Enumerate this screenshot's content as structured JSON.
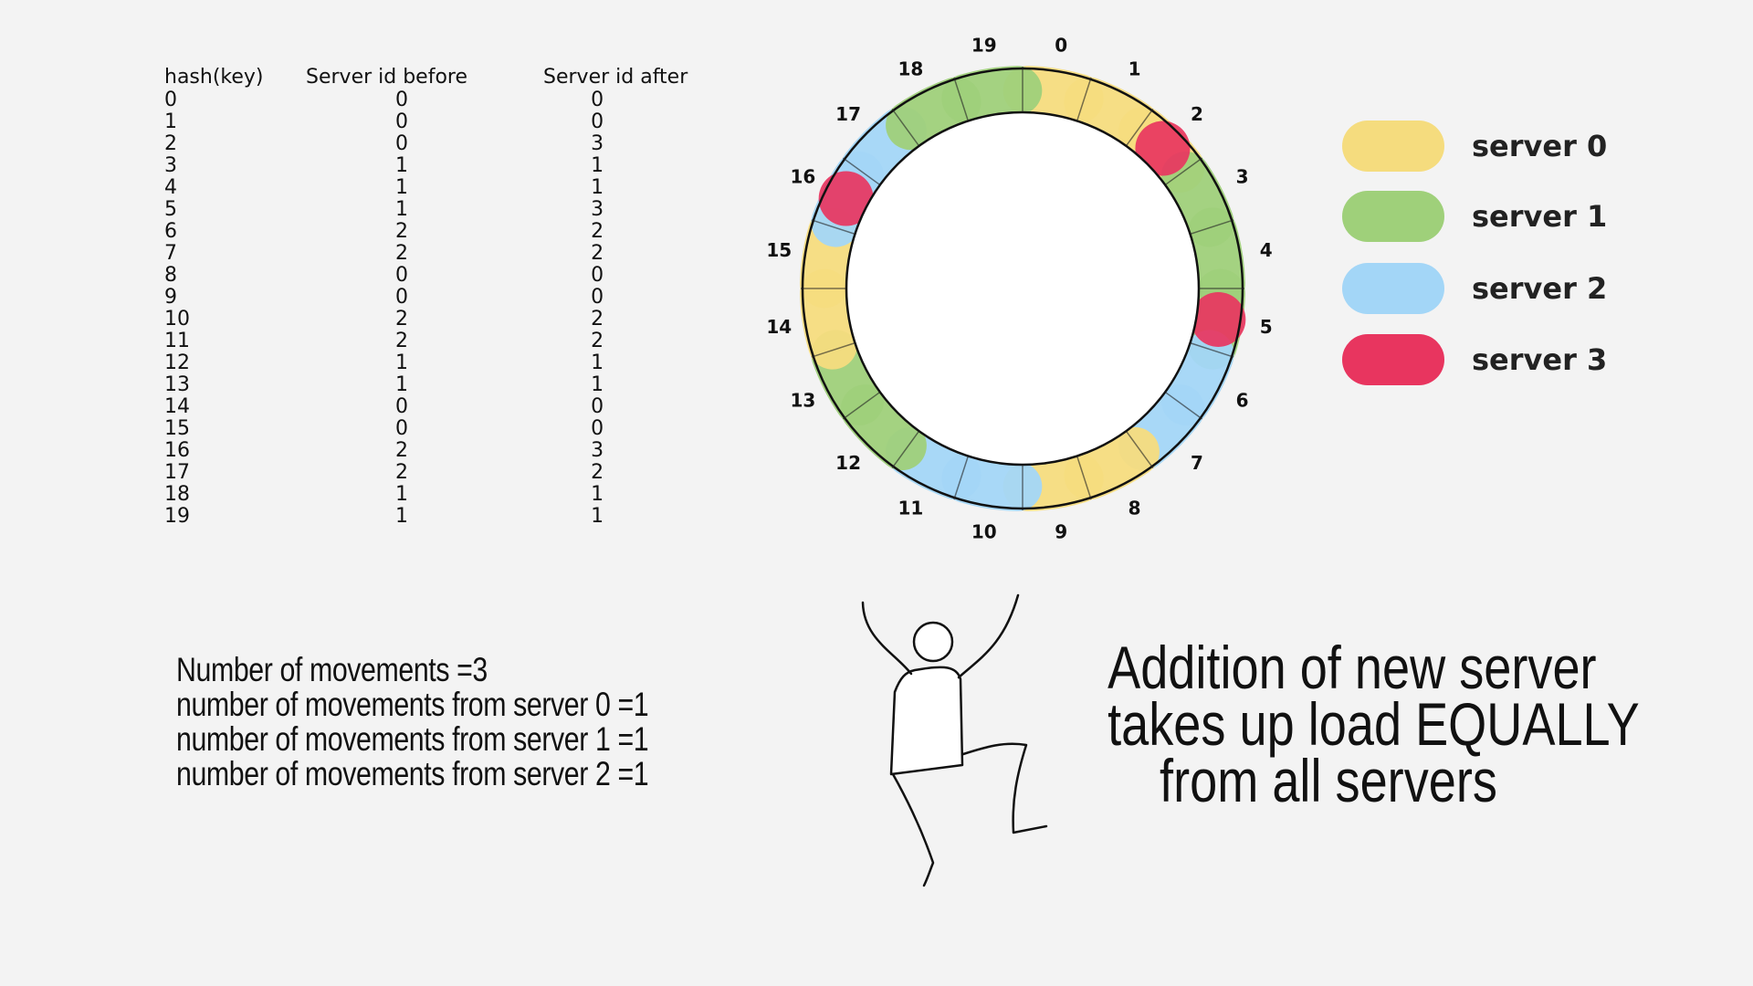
{
  "table": {
    "headers": [
      "hash(key)",
      "Server id  before",
      "Server id after"
    ],
    "rows": [
      [
        "0",
        "0",
        "0"
      ],
      [
        "1",
        "0",
        "0"
      ],
      [
        "2",
        "0",
        "3"
      ],
      [
        "3",
        "1",
        "1"
      ],
      [
        "4",
        "1",
        "1"
      ],
      [
        "5",
        "1",
        "3"
      ],
      [
        "6",
        "2",
        "2"
      ],
      [
        "7",
        "2",
        "2"
      ],
      [
        "8",
        "0",
        "0"
      ],
      [
        "9",
        "0",
        "0"
      ],
      [
        "10",
        "2",
        "2"
      ],
      [
        "11",
        "2",
        "2"
      ],
      [
        "12",
        "1",
        "1"
      ],
      [
        "13",
        "1",
        "1"
      ],
      [
        "14",
        "0",
        "0"
      ],
      [
        "15",
        "0",
        "0"
      ],
      [
        "16",
        "2",
        "3"
      ],
      [
        "17",
        "2",
        "2"
      ],
      [
        "18",
        "1",
        "1"
      ],
      [
        "19",
        "1",
        "1"
      ]
    ]
  },
  "stats": [
    "Number of movements =3",
    "number of movements from server 0 =1",
    "number of movements from server 1 =1",
    "number of movements from server 2 =1"
  ],
  "headline": [
    "Addition of new server",
    "takes up load EQUALLY",
    "from all servers"
  ],
  "legend": [
    {
      "label": "server 0",
      "color": "#f5dc7e"
    },
    {
      "label": "server 1",
      "color": "#9fd07a"
    },
    {
      "label": "server 2",
      "color": "#a3d6f7"
    },
    {
      "label": "server 3",
      "color": "#e8355f"
    }
  ],
  "ring": {
    "slot_labels": [
      "0",
      "1",
      "2",
      "3",
      "4",
      "5",
      "6",
      "7",
      "8",
      "9",
      "10",
      "11",
      "12",
      "13",
      "14",
      "15",
      "16",
      "17",
      "18",
      "19"
    ],
    "slot_servers": [
      0,
      0,
      3,
      1,
      1,
      3,
      2,
      2,
      0,
      0,
      2,
      2,
      1,
      1,
      0,
      0,
      3,
      2,
      1,
      1
    ]
  }
}
